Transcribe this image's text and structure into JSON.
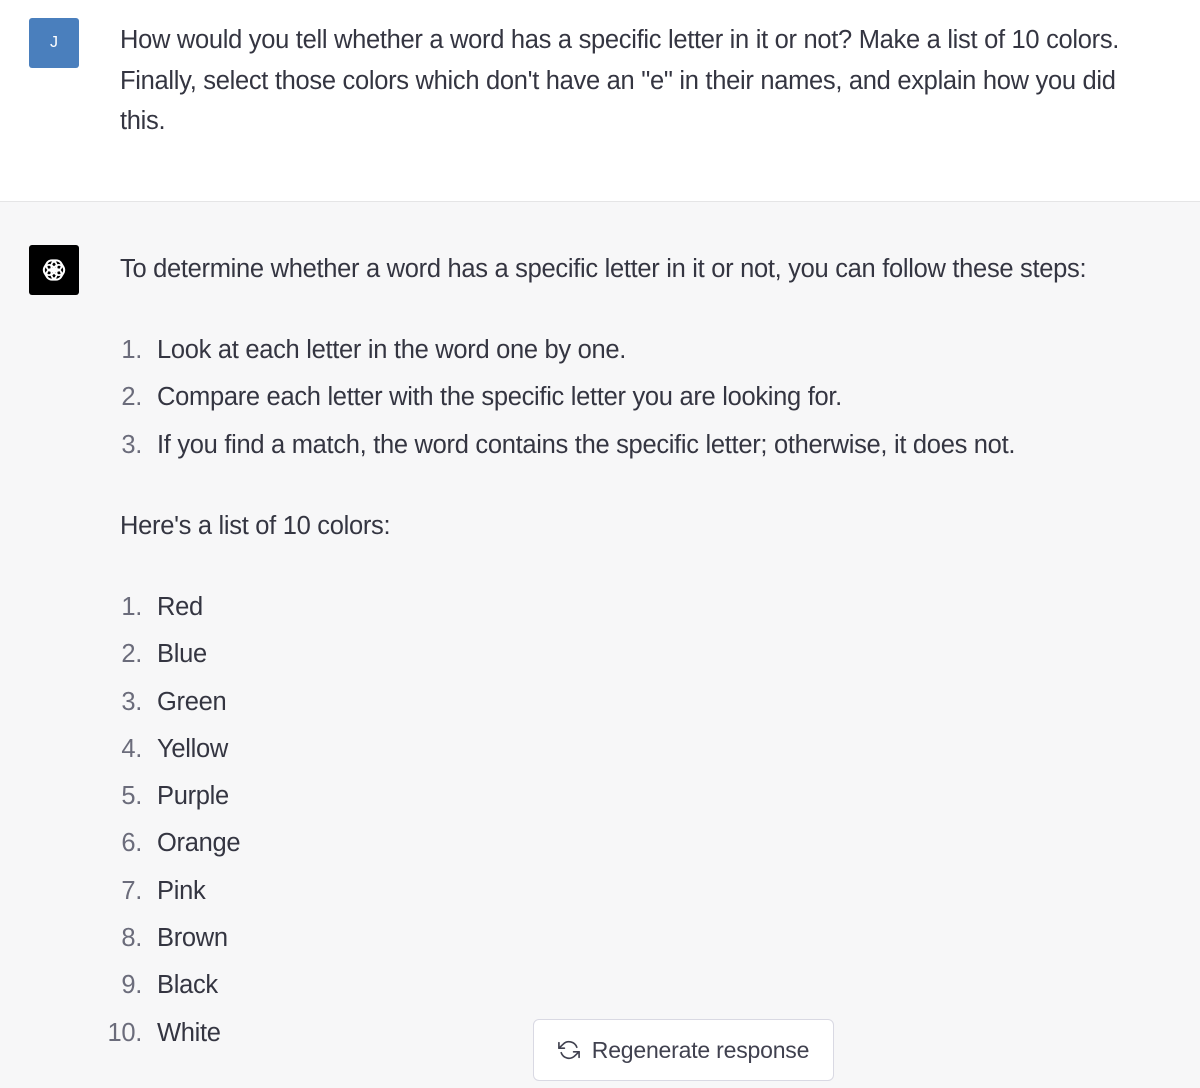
{
  "user": {
    "avatar_initial": "J",
    "message_line_1": "How would you tell whether a word has a specific letter in it or not? Make a list of 10 colors.",
    "message_line_2": "Finally, select those colors which don't have an \"e\" in their names, and explain how you did",
    "message_line_3": "this."
  },
  "assistant": {
    "avatar_icon": "openai-logo-icon",
    "intro": "To determine whether a word has a specific letter in it or not, you can follow these steps:",
    "steps": [
      {
        "num": "1.",
        "text": "Look at each letter in the word one by one."
      },
      {
        "num": "2.",
        "text": "Compare each letter with the specific letter you are looking for."
      },
      {
        "num": "3.",
        "text": "If you find a match, the word contains the specific letter; otherwise, it does not."
      }
    ],
    "colors_heading": "Here's a list of 10 colors:",
    "colors": [
      {
        "num": "1.",
        "text": "Red"
      },
      {
        "num": "2.",
        "text": "Blue"
      },
      {
        "num": "3.",
        "text": "Green"
      },
      {
        "num": "4.",
        "text": "Yellow"
      },
      {
        "num": "5.",
        "text": "Purple"
      },
      {
        "num": "6.",
        "text": "Orange"
      },
      {
        "num": "7.",
        "text": "Pink"
      },
      {
        "num": "8.",
        "text": "Brown"
      },
      {
        "num": "9.",
        "text": "Black"
      },
      {
        "num": "10.",
        "text": "White"
      }
    ]
  },
  "regenerate": {
    "label": "Regenerate response",
    "icon": "refresh-icon"
  },
  "colors_theme": {
    "user_avatar_bg": "#4a7fbd",
    "assistant_bg": "#f7f7f8",
    "assistant_avatar_bg": "#000000",
    "text": "#343541",
    "list_number": "#6b6c7b"
  }
}
